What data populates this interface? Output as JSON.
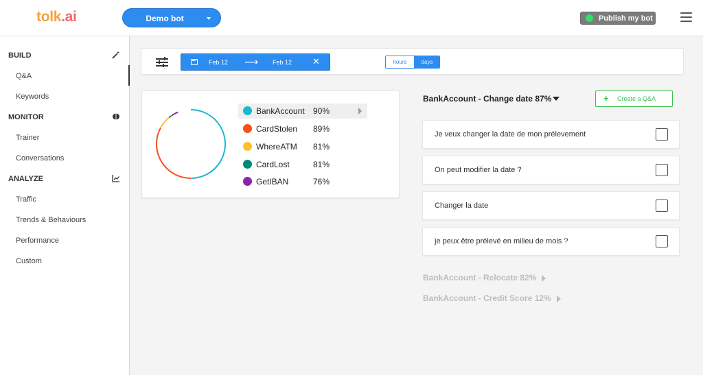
{
  "header": {
    "logo_part1": "tolk",
    "logo_part2": ".ai",
    "bot_selector": "Demo bot",
    "publish_label": "Publish my bot"
  },
  "sidebar": {
    "sections": [
      {
        "title": "BUILD",
        "icon": "magic-wand-icon",
        "items": [
          "Q&A",
          "Keywords"
        ]
      },
      {
        "title": "MONITOR",
        "icon": "brain-icon",
        "items": [
          "Trainer",
          "Conversations"
        ]
      },
      {
        "title": "ANALYZE",
        "icon": "line-chart-icon",
        "items": [
          "Traffic",
          "Trends & Behaviours",
          "Performance",
          "Custom"
        ]
      }
    ],
    "active_item": "Q&A"
  },
  "filter": {
    "date_from": "Feb 12",
    "date_to": "Feb 12",
    "granularity_options": [
      "hours",
      "days"
    ],
    "granularity_selected": "days"
  },
  "intents": {
    "items": [
      {
        "name": "BankAccount",
        "percent": "90%",
        "color": "#1ab8cc",
        "value": 90
      },
      {
        "name": "CardStolen",
        "percent": "89%",
        "color": "#f4511e",
        "value": 89
      },
      {
        "name": "WhereATM",
        "percent": "81%",
        "color": "#fbc02d",
        "value": 81
      },
      {
        "name": "CardLost",
        "percent": "81%",
        "color": "#00897b",
        "value": 81
      },
      {
        "name": "GetIBAN",
        "percent": "76%",
        "color": "#8e24aa",
        "value": 76
      }
    ],
    "selected": "BankAccount"
  },
  "detail": {
    "title": "BankAccount - Change date 87%",
    "create_label": "Create a Q&A",
    "questions": [
      "Je veux changer la date de mon prélevement",
      "On peut modifier la date ?",
      "Changer la date",
      "je peux être prélevé en milieu de mois ?"
    ],
    "collapsed_groups": [
      "BankAccount - Relocate 82%",
      "BankAccount - Credit Score 12%"
    ]
  }
}
